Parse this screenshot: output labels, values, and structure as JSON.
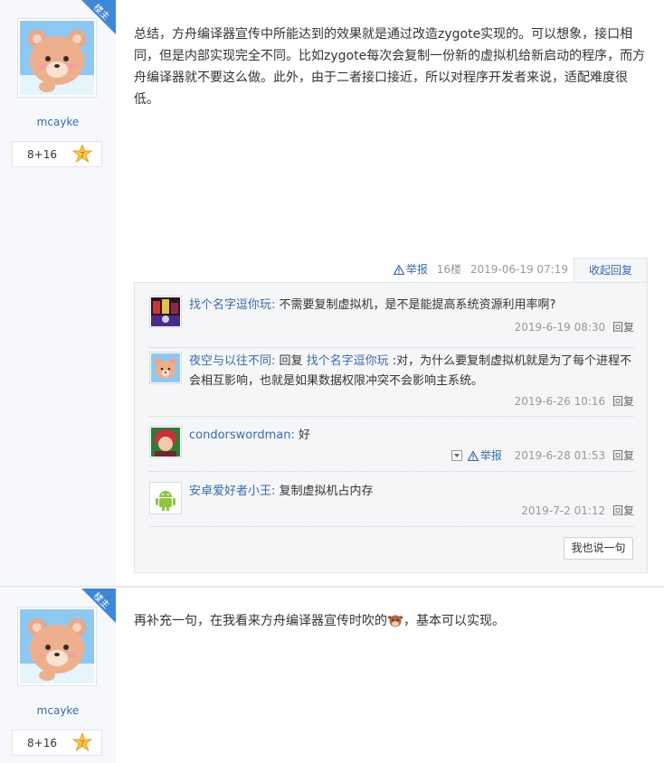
{
  "post1": {
    "corner_label": "楼主",
    "username": "mcayke",
    "level_text": "8+16",
    "level_badge": "7",
    "content": "总结，方舟编译器宣传中所能达到的效果就是通过改造zygote实现的。可以想象，接口相同，但是内部实现完全不同。比如zygote每次会复制一份新的虚拟机给新启动的程序，而方舟编译器就不要这么做。此外，由于二者接口接近，所以对程序开发者来说，适配难度很低。",
    "meta": {
      "report": "举报",
      "floor": "16楼",
      "date": "2019-06-19 07:19",
      "collapse": "收起回复"
    },
    "replies": [
      {
        "user": "找个名字逗你玩:",
        "text": " 不需要复制虚拟机，是不是能提高系统资源利用率啊?",
        "date": "2019-6-19 08:30",
        "reply_label": "回复"
      },
      {
        "user": "夜空与以往不同:",
        "prefix": " 回复 ",
        "target": "找个名字逗你玩",
        "text": " :对，为什么要复制虚拟机就是为了每个进程不会相互影响，也就是如果数据权限冲突不会影响主系统。",
        "date": "2019-6-26 10:16",
        "reply_label": "回复"
      },
      {
        "user": "condorswordman:",
        "text": " 好",
        "report": "举报",
        "date": "2019-6-28 01:53",
        "reply_label": "回复"
      },
      {
        "user": "安卓爱好者小王:",
        "text": " 复制虚拟机占内存",
        "date": "2019-7-2 01:12",
        "reply_label": "回复"
      }
    ],
    "say_button": "我也说一句"
  },
  "post2": {
    "corner_label": "楼主",
    "username": "mcayke",
    "level_text": "8+16",
    "level_badge": "7",
    "content_before": "再补充一句，在我看来方舟编译器宣传时吹的",
    "content_after": "，基本可以实现。"
  },
  "colors": {
    "link": "#3a6bb0",
    "corner": "#3e86d6",
    "sidebar": "#f6f8fb",
    "reply_bg": "#f5f6f8"
  },
  "icons": [
    "bear-avatar",
    "level-star-badge",
    "warning-icon",
    "dropdown-icon",
    "cow-emoji"
  ]
}
